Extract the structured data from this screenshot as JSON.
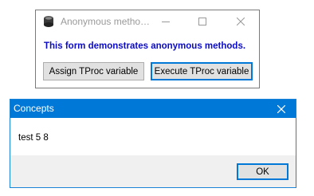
{
  "main_window": {
    "title": "Anonymous metho…",
    "heading": "This form demonstrates anonymous methods.",
    "assign_button_label": "Assign TProc variable",
    "execute_button_label": "Execute TProc variable",
    "icons": {
      "app": "app-icon",
      "minimize": "minimize-icon",
      "maximize": "maximize-icon",
      "close": "close-icon"
    }
  },
  "dialog": {
    "title": "Concepts",
    "message": "test 5 8",
    "ok_label": "OK",
    "icons": {
      "close": "close-icon"
    },
    "accent_color": "#0078d7"
  }
}
